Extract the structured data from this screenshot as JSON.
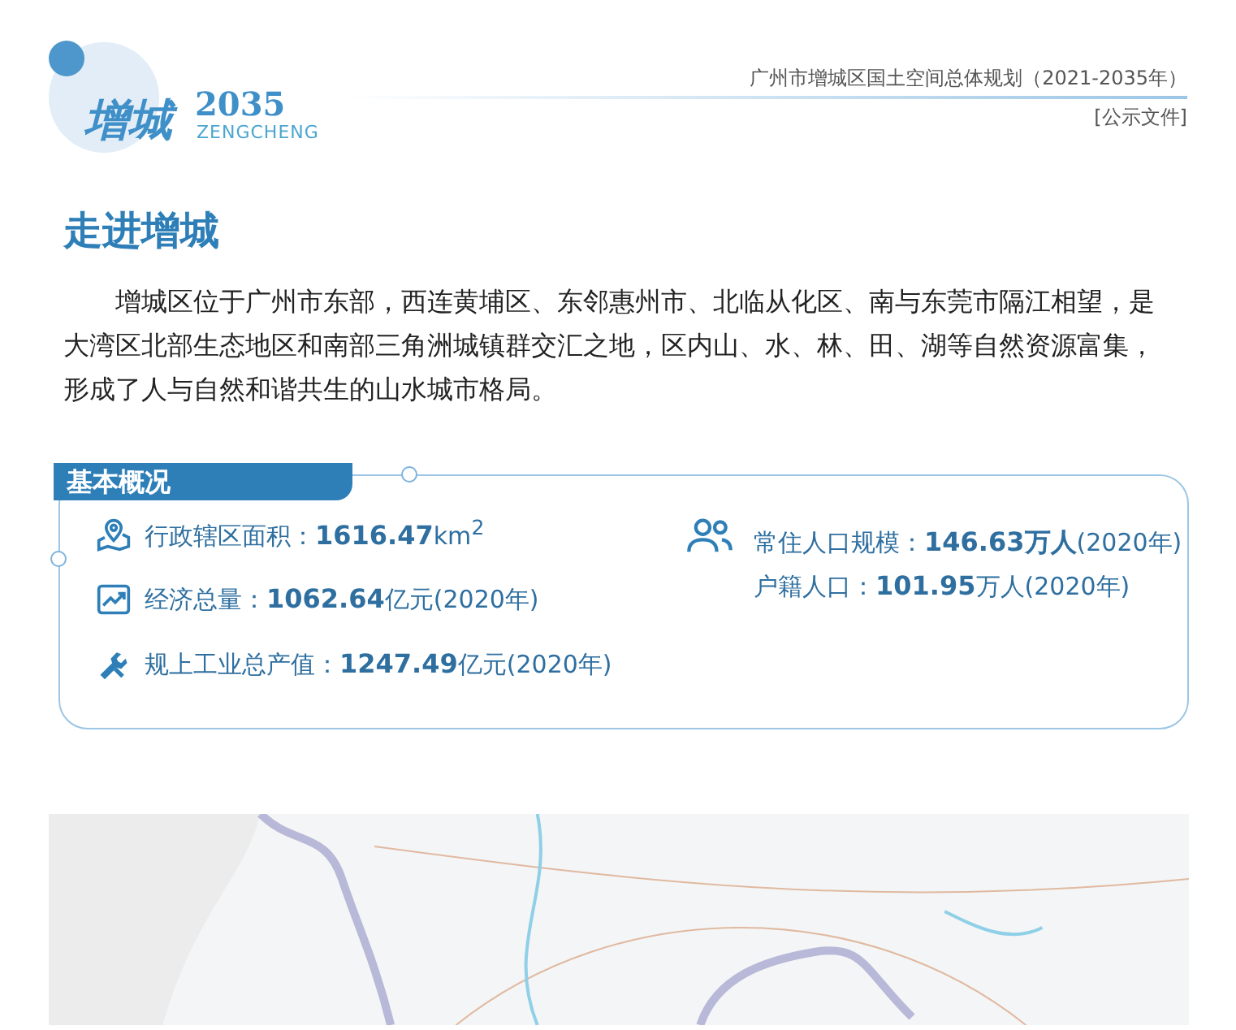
{
  "header": {
    "logo_text": "增城",
    "logo_year": "2035",
    "logo_sub": "ZENGCHENG",
    "doc_title": "广州市增城区国土空间总体规划（2021-2035年）",
    "doc_status": "[公示文件]"
  },
  "heading": "走进增城",
  "intro": "增城区位于广州市东部，西连黄埔区、东邻惠州市、北临从化区、南与东莞市隔江相望，是大湾区北部生态地区和南部三角洲城镇群交汇之地，区内山、水、林、田、湖等自然资源富集，形成了人与自然和谐共生的山水城市格局。",
  "overview": {
    "title": "基本概况",
    "left": [
      {
        "kind": "location",
        "text": "行政辖区面积：**1616.47**km$^{2}$"
      },
      {
        "kind": "chart",
        "text": "经济总量：**1062.64**亿元(2020年)"
      },
      {
        "kind": "tools",
        "text": "规上工业总产值：**1247.49**亿元(2020年)"
      }
    ],
    "right": {
      "kind": "people",
      "lines": [
        "常住人口规模：**146.63万人**(2020年)",
        "户籍人口：**101.95**万人(2020年)"
      ]
    }
  }
}
